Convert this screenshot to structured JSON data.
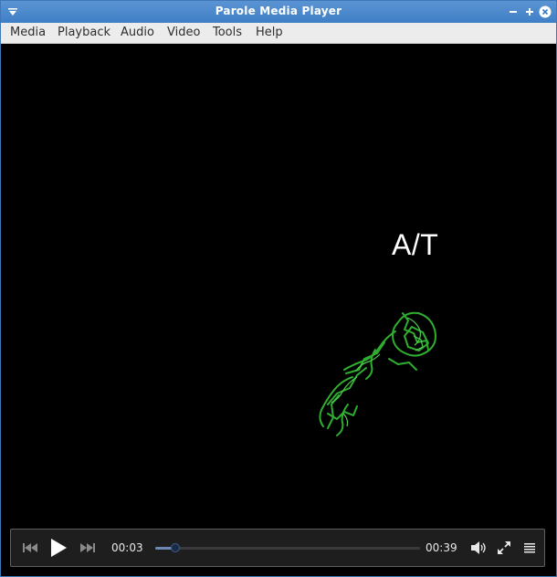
{
  "window": {
    "title": "Parole Media Player"
  },
  "menubar": {
    "items": [
      "Media",
      "Playback",
      "Audio",
      "Video",
      "Tools",
      "Help"
    ]
  },
  "video": {
    "overlay_text": "A/T"
  },
  "controls": {
    "current_time": "00:03",
    "total_time": "00:39",
    "progress": 0.077,
    "icons": [
      "skip-back-icon",
      "play-icon",
      "skip-forward-icon",
      "volume-icon",
      "fullscreen-icon",
      "playlist-icon"
    ]
  },
  "colors": {
    "titlebar": "#3f7fc6",
    "menubar": "#ececec",
    "video_bg": "#000000",
    "molecule": "#2fae2f",
    "controls_bg": "#1e1e1e",
    "seek_accent": "#6d89b3"
  }
}
